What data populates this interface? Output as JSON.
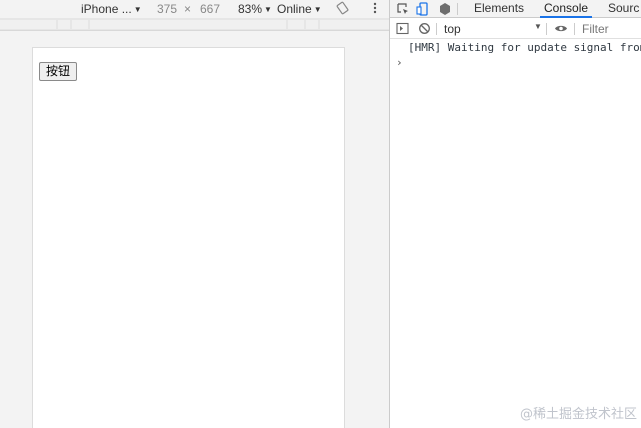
{
  "device_toolbar": {
    "device": "iPhone ...",
    "width": "375",
    "times": "×",
    "height": "667",
    "zoom": "83%",
    "network": "Online"
  },
  "page": {
    "button_label": "按钮"
  },
  "devtools": {
    "tabs": [
      "Elements",
      "Console",
      "Sourc"
    ],
    "active_tab": "Console",
    "context": "top",
    "filter_placeholder": "Filter"
  },
  "console": {
    "messages": [
      "[HMR] Waiting for update signal from"
    ],
    "prompt": "›"
  },
  "watermark": "@稀土掘金技术社区",
  "colors": {
    "accent": "#1a73e8",
    "panel_bg": "#f3f3f3"
  },
  "icons": [
    "dropdown-arrow-icon",
    "rotate-icon",
    "more-vertical-icon",
    "inspect-element-icon",
    "device-toggle-icon",
    "extension-icon",
    "sidebar-toggle-icon",
    "clear-console-icon",
    "eye-icon"
  ]
}
